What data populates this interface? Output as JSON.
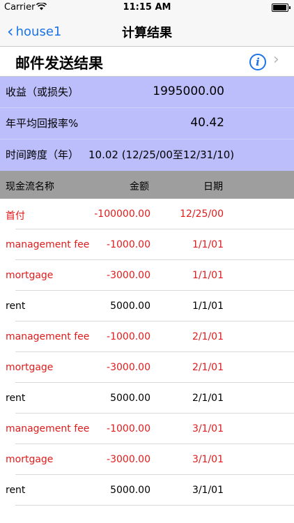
{
  "status_bar": {
    "carrier": "Carrier",
    "time": "11:15 AM"
  },
  "nav": {
    "back_label": "house1",
    "title": "计算结果"
  },
  "mail": {
    "label": "邮件发送结果"
  },
  "summary": {
    "gain_label": "收益（或损失）",
    "gain_value": "1995000.00",
    "annual_label": "年平均回报率%",
    "annual_value": "40.42",
    "span_label": "时间跨度（年）",
    "span_value": "10.02 (12/25/00至12/31/10)"
  },
  "table": {
    "headers": [
      "现金流名称",
      "金额",
      "日期"
    ],
    "rows": [
      {
        "name": "首付",
        "amount": "-100000.00",
        "date": "12/25/00",
        "negative": true
      },
      {
        "name": "management fee",
        "amount": "-1000.00",
        "date": "1/1/01",
        "negative": true
      },
      {
        "name": "mortgage",
        "amount": "-3000.00",
        "date": "1/1/01",
        "negative": true
      },
      {
        "name": "rent",
        "amount": "5000.00",
        "date": "1/1/01",
        "negative": false
      },
      {
        "name": "management fee",
        "amount": "-1000.00",
        "date": "2/1/01",
        "negative": true
      },
      {
        "name": "mortgage",
        "amount": "-3000.00",
        "date": "2/1/01",
        "negative": true
      },
      {
        "name": "rent",
        "amount": "5000.00",
        "date": "2/1/01",
        "negative": false
      },
      {
        "name": "management fee",
        "amount": "-1000.00",
        "date": "3/1/01",
        "negative": true
      },
      {
        "name": "mortgage",
        "amount": "-3000.00",
        "date": "3/1/01",
        "negative": true
      },
      {
        "name": "rent",
        "amount": "5000.00",
        "date": "3/1/01",
        "negative": false
      }
    ]
  }
}
